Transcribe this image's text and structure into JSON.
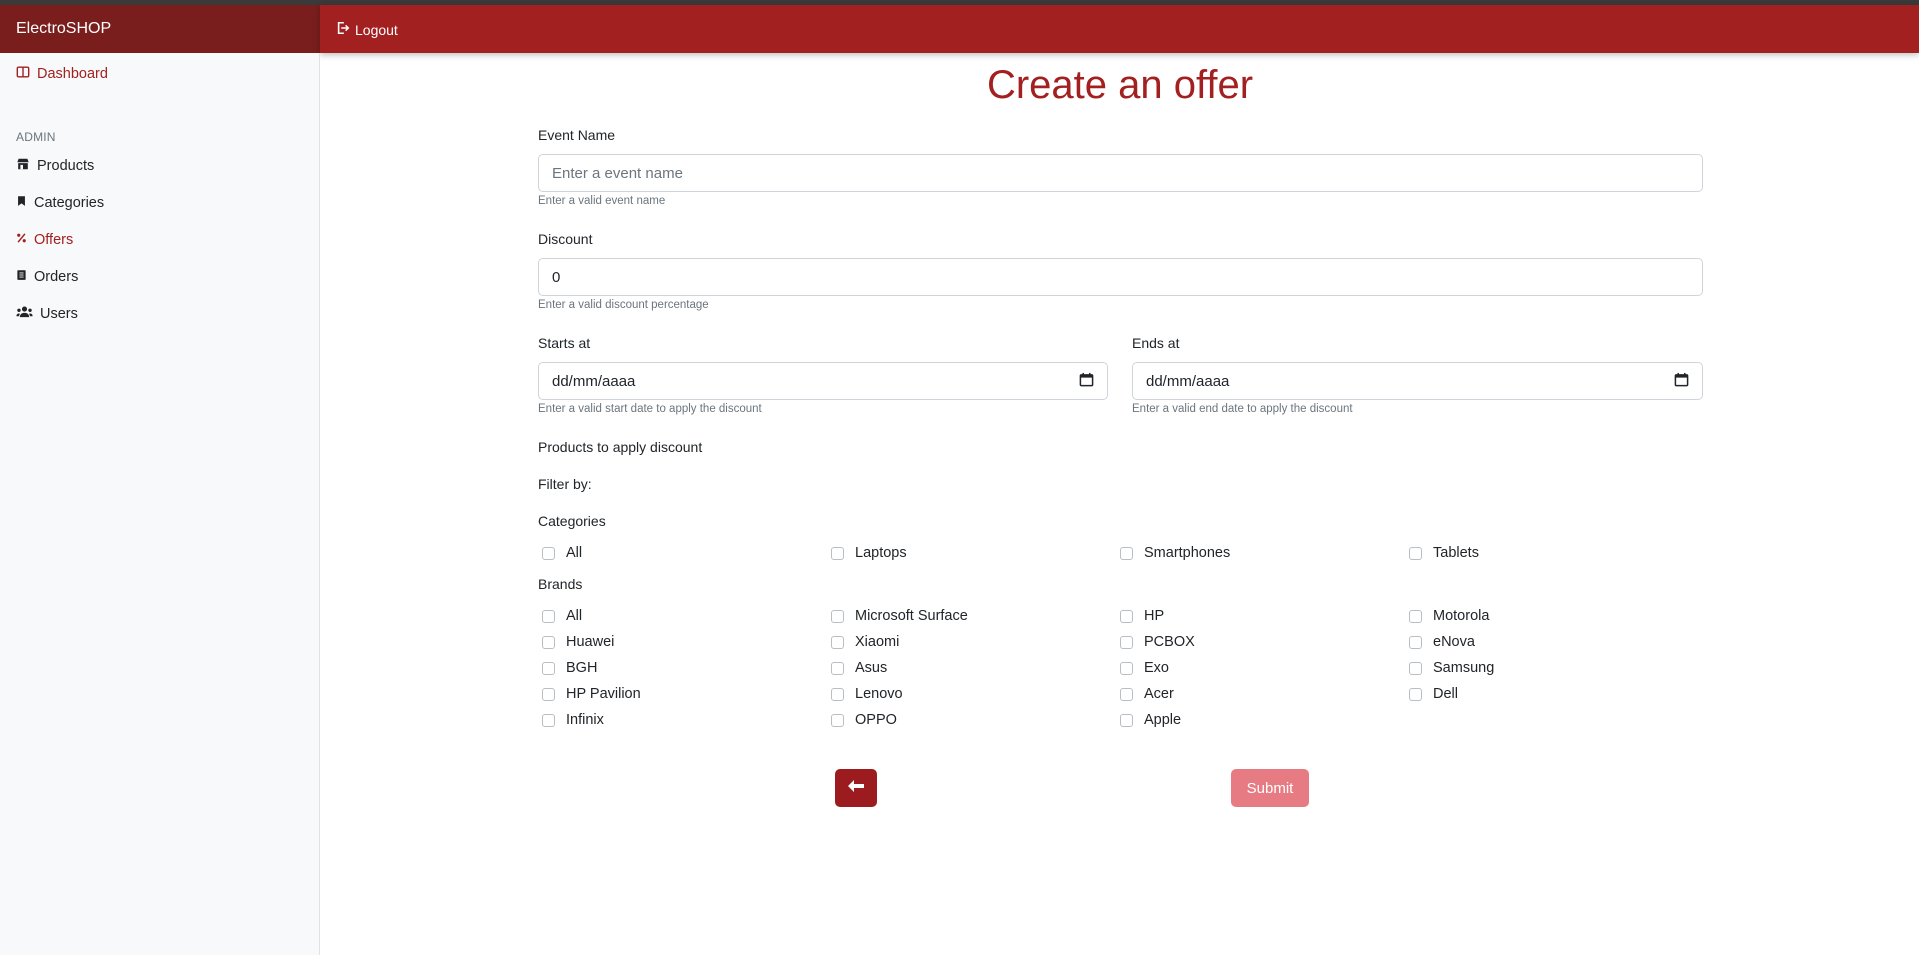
{
  "app": {
    "brand": "ElectroSHOP"
  },
  "navbar": {
    "logout_label": "Logout"
  },
  "sidebar": {
    "dashboard": "Dashboard",
    "section_admin": "ADMIN",
    "items": [
      {
        "label": "Products",
        "icon": "store-icon"
      },
      {
        "label": "Categories",
        "icon": "bookmark-icon"
      },
      {
        "label": "Offers",
        "icon": "percent-icon",
        "active": true
      },
      {
        "label": "Orders",
        "icon": "receipt-icon"
      },
      {
        "label": "Users",
        "icon": "users-icon"
      }
    ]
  },
  "form": {
    "title": "Create an offer",
    "event_name": {
      "label": "Event Name",
      "placeholder": "Enter a event name",
      "help": "Enter a valid event name"
    },
    "discount": {
      "label": "Discount",
      "value": "0",
      "help": "Enter a valid discount percentage"
    },
    "starts_at": {
      "label": "Starts at",
      "placeholder": "dd/mm/aaaa",
      "help": "Enter a valid start date to apply the discount"
    },
    "ends_at": {
      "label": "Ends at",
      "placeholder": "dd/mm/aaaa",
      "help": "Enter a valid end date to apply the discount"
    },
    "products_heading": "Products to apply discount",
    "filter_by": "Filter by:",
    "categories_label": "Categories",
    "categories": [
      "All",
      "Laptops",
      "Smartphones",
      "Tablets"
    ],
    "brands_label": "Brands",
    "brands": [
      "All",
      "Microsoft Surface",
      "HP",
      "Motorola",
      "Huawei",
      "Xiaomi",
      "PCBOX",
      "eNova",
      "BGH",
      "Asus",
      "Exo",
      "Samsung",
      "HP Pavilion",
      "Lenovo",
      "Acer",
      "Dell",
      "Infinix",
      "OPPO",
      "Apple"
    ],
    "back_icon": "arrow-left-icon",
    "submit_label": "Submit"
  },
  "colors": {
    "brand_dark": "#7a1d1d",
    "navbar": "#a32021",
    "accent": "#a32021",
    "submit_disabled": "#e67b84"
  }
}
